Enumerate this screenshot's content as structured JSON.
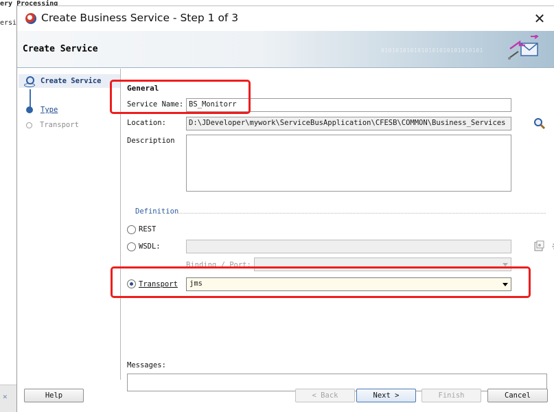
{
  "background": {
    "fragment_top": "ery Processing",
    "fragment_side": "ersi"
  },
  "dialog": {
    "title": "Create Business Service - Step 1 of 3",
    "header": "Create Service",
    "binary_decoration": "0101010101010101010101010101"
  },
  "nav": {
    "steps": [
      {
        "label": "Create Service",
        "state": "current"
      },
      {
        "label": "Type",
        "state": "link"
      },
      {
        "label": "Transport",
        "state": "disabled"
      }
    ]
  },
  "general": {
    "section_title": "General",
    "service_name_label": "Service Name:",
    "service_name_value": "BS_Monitorr",
    "location_label": "Location:",
    "location_value": "D:\\JDeveloper\\mywork\\ServiceBusApplication\\CFESB\\COMMON\\Business_Services",
    "description_label": "Description",
    "description_value": ""
  },
  "definition": {
    "title": "Definition",
    "rest_label": "REST",
    "wsdl_label": "WSDL:",
    "wsdl_value": "",
    "binding_port_label": "Binding / Port:",
    "transport_label": "Transport",
    "transport_value": "jms",
    "selected": "Transport"
  },
  "messages": {
    "label": "Messages:",
    "value": ""
  },
  "buttons": {
    "help": "Help",
    "back": "< Back",
    "next": "Next >",
    "finish": "Finish",
    "cancel": "Cancel"
  },
  "colors": {
    "highlight": "#ee1d1d",
    "nav_accent": "#2e5c9e",
    "transport_select_bg": "#fffbea"
  }
}
